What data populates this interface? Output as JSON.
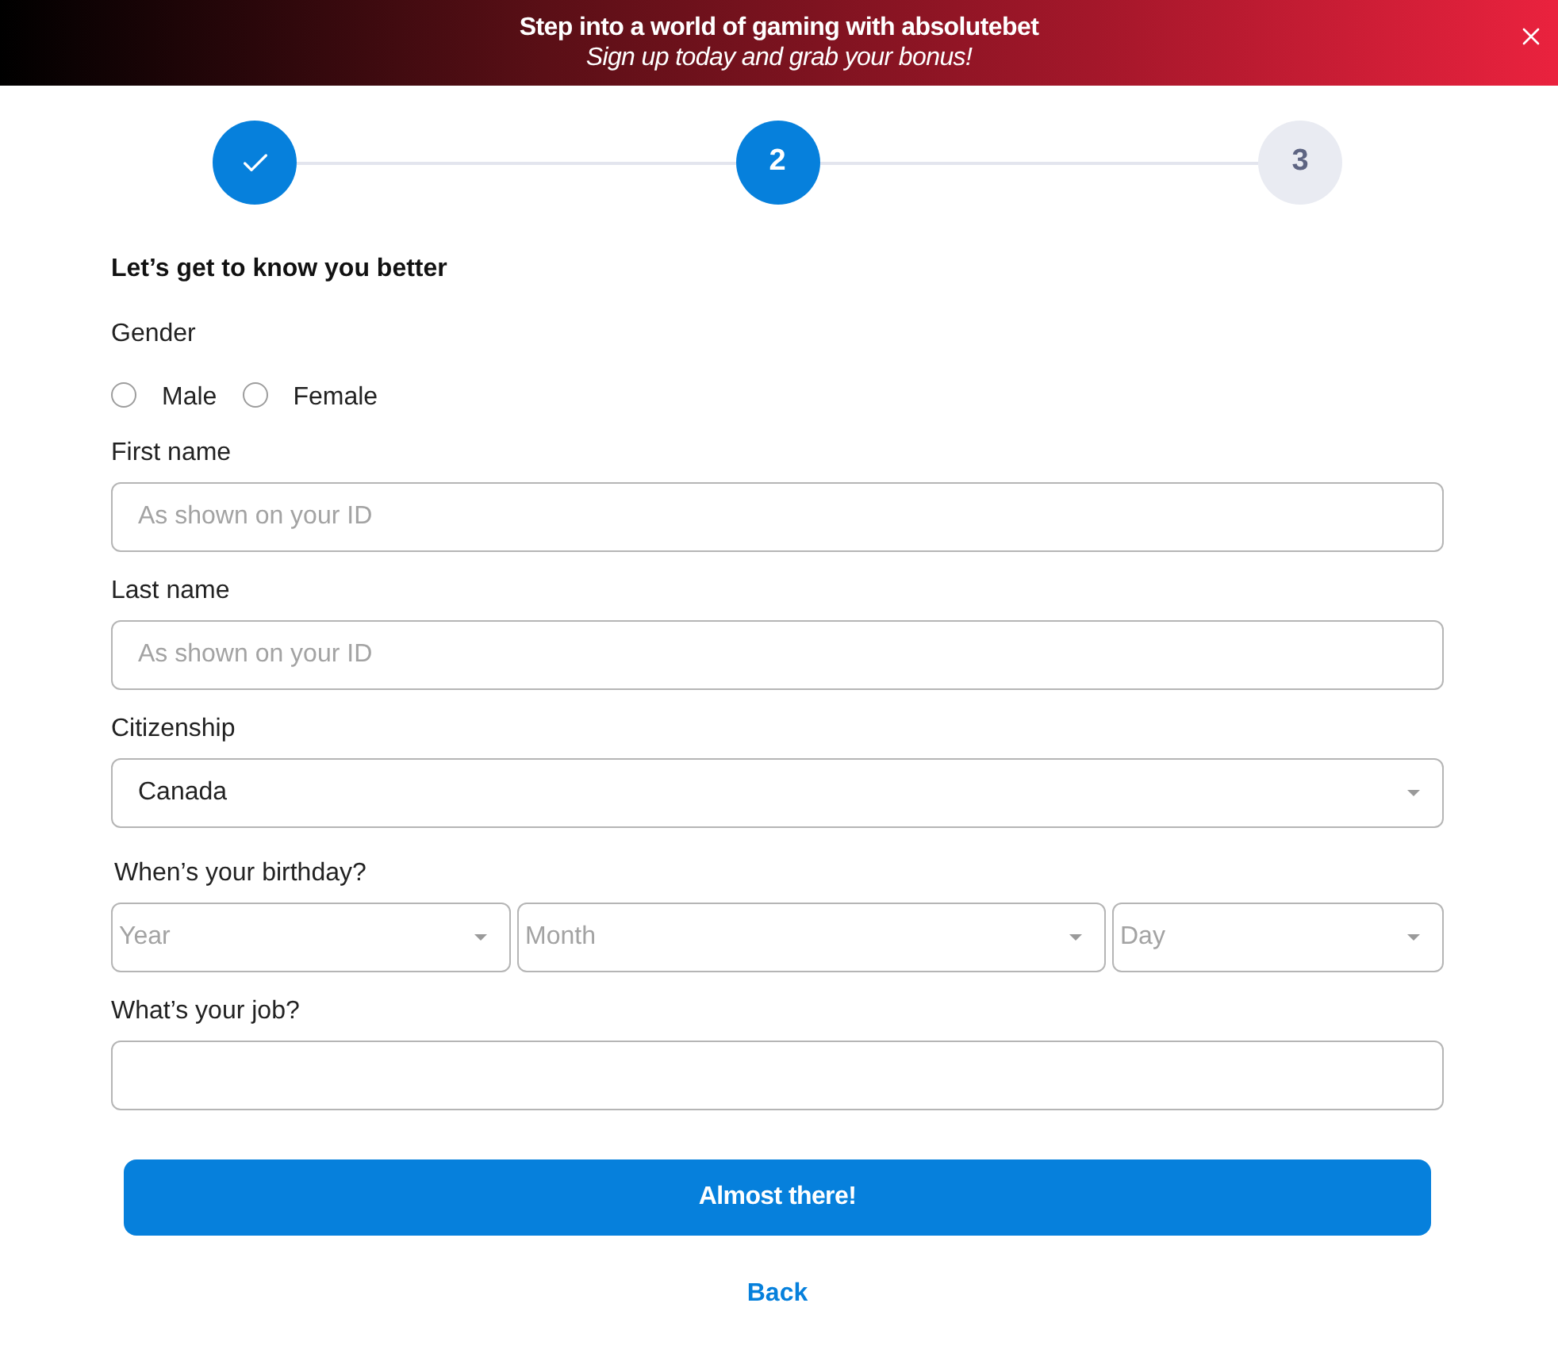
{
  "banner": {
    "title": "Step into a world of gaming with absolutebet",
    "subtitle": "Sign up today and grab your bonus!"
  },
  "steps": [
    {
      "kind": "done"
    },
    {
      "kind": "current",
      "label": "2"
    },
    {
      "kind": "upcoming",
      "label": "3"
    }
  ],
  "form": {
    "heading": "Let’s get to know you better",
    "gender": {
      "label": "Gender",
      "options": [
        {
          "label": "Male",
          "selected": false
        },
        {
          "label": "Female",
          "selected": false
        }
      ]
    },
    "fields": [
      {
        "kind": "text",
        "label": "First name",
        "placeholder": "As shown on your ID"
      },
      {
        "kind": "text",
        "label": "Last name",
        "placeholder": "As shown on your ID"
      },
      {
        "kind": "select",
        "label": "Citizenship",
        "value": "Canada"
      },
      {
        "kind": "date",
        "label": "When’s your birthday?",
        "parts": [
          {
            "placeholder": "Year"
          },
          {
            "placeholder": "Month"
          },
          {
            "placeholder": "Day"
          }
        ]
      },
      {
        "kind": "text",
        "label": "What’s your job?"
      }
    ],
    "submit": "Almost there!",
    "back": "Back"
  }
}
